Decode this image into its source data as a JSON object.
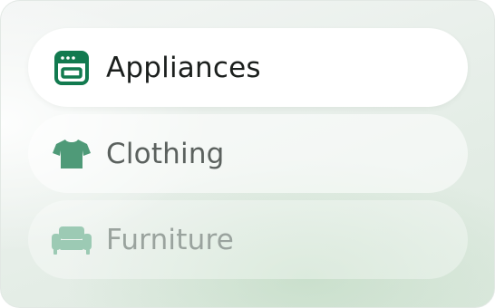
{
  "categories": [
    {
      "label": "Appliances",
      "icon": "oven-icon",
      "state": "active",
      "color": "#127a4f"
    },
    {
      "label": "Clothing",
      "icon": "tshirt-icon",
      "state": "normal",
      "color": "#4f9a78"
    },
    {
      "label": "Furniture",
      "icon": "sofa-icon",
      "state": "faded",
      "color": "#9ccab4"
    }
  ]
}
